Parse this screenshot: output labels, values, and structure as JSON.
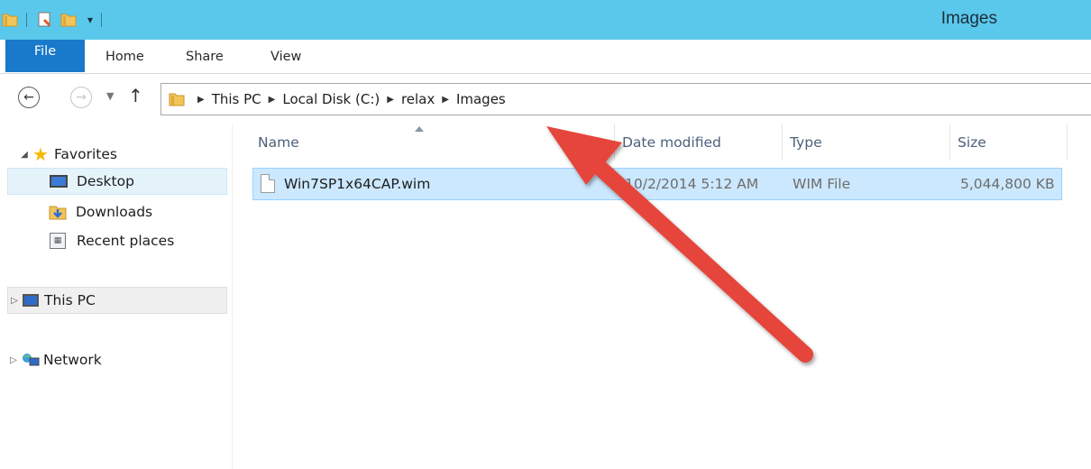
{
  "window": {
    "title": "Images"
  },
  "ribbon": {
    "tabs": [
      "File",
      "Home",
      "Share",
      "View"
    ]
  },
  "address": {
    "crumbs": [
      "This PC",
      "Local Disk (C:)",
      "relax",
      "Images"
    ]
  },
  "nav": {
    "favorites": "Favorites",
    "desktop": "Desktop",
    "downloads": "Downloads",
    "recent": "Recent places",
    "thispc": "This PC",
    "network": "Network"
  },
  "columns": [
    "Name",
    "Date modified",
    "Type",
    "Size"
  ],
  "files": [
    {
      "name": "Win7SP1x64CAP.wim",
      "date": "10/2/2014 5:12 AM",
      "type": "WIM File",
      "size": "5,044,800 KB"
    }
  ],
  "colors": {
    "titlebar": "#5ac8ea",
    "file_tab": "#1979ca",
    "selection": "#cce8ff",
    "annotation_arrow": "#e5453a"
  }
}
